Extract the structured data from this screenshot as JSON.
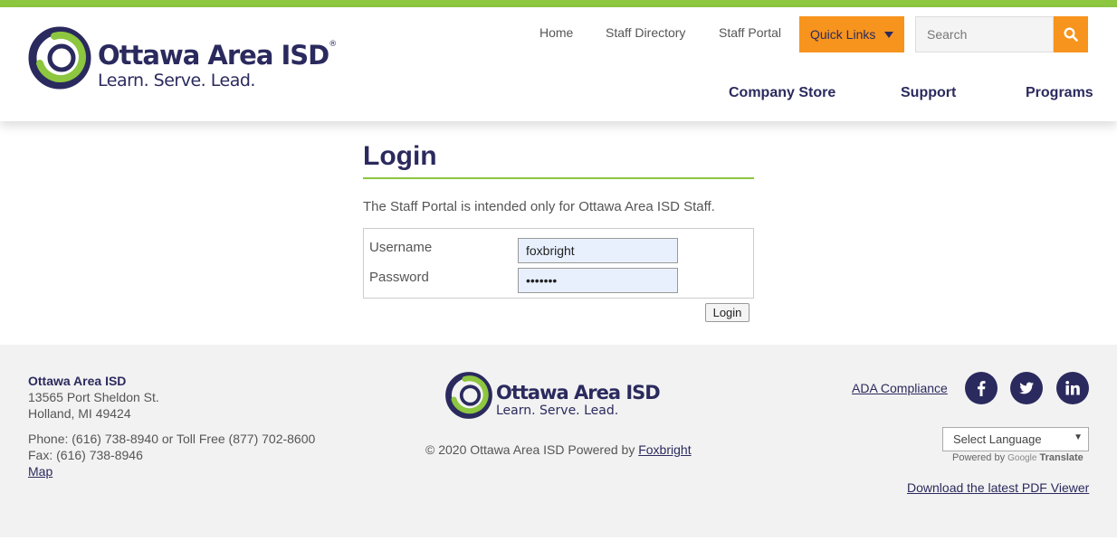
{
  "brand": {
    "name": "Ottawa Area ISD",
    "reg": "®",
    "tagline": "Learn. Serve. Lead."
  },
  "top_nav": [
    {
      "label": "Home"
    },
    {
      "label": "Staff Directory"
    },
    {
      "label": "Staff Portal"
    }
  ],
  "quick_links": {
    "label": "Quick Links",
    "icon": "caret-down-icon"
  },
  "search": {
    "placeholder": "Search",
    "icon": "search-icon"
  },
  "main_nav": [
    {
      "label": "Company Store"
    },
    {
      "label": "Support"
    },
    {
      "label": "Programs"
    }
  ],
  "login": {
    "title": "Login",
    "intro": "The Staff Portal is intended only for Ottawa Area ISD Staff.",
    "username_label": "Username",
    "username_value": "foxbright",
    "password_label": "Password",
    "password_value": "•••••••",
    "button_label": "Login"
  },
  "footer": {
    "org": "Ottawa Area ISD",
    "address1": "13565 Port Sheldon St.",
    "address2": "Holland, MI 49424",
    "phone": "Phone: (616) 738-8940 or Toll Free (877) 702-8600",
    "fax": "Fax: (616) 738-8946",
    "map": "Map",
    "copyright": "© 2020 Ottawa Area ISD Powered by",
    "powered_link": "Foxbright",
    "ada": "ADA Compliance",
    "social": [
      {
        "name": "facebook-icon"
      },
      {
        "name": "twitter-icon"
      },
      {
        "name": "linkedin-icon"
      }
    ],
    "language": "Select Language",
    "powered_by": "Powered by",
    "google": "Google",
    "translate": "Translate",
    "pdf": "Download the latest PDF Viewer"
  },
  "colors": {
    "navy": "#2b2a5e",
    "green": "#8dc63f",
    "orange": "#f7941d",
    "footer_bg": "#f2f2f2"
  }
}
